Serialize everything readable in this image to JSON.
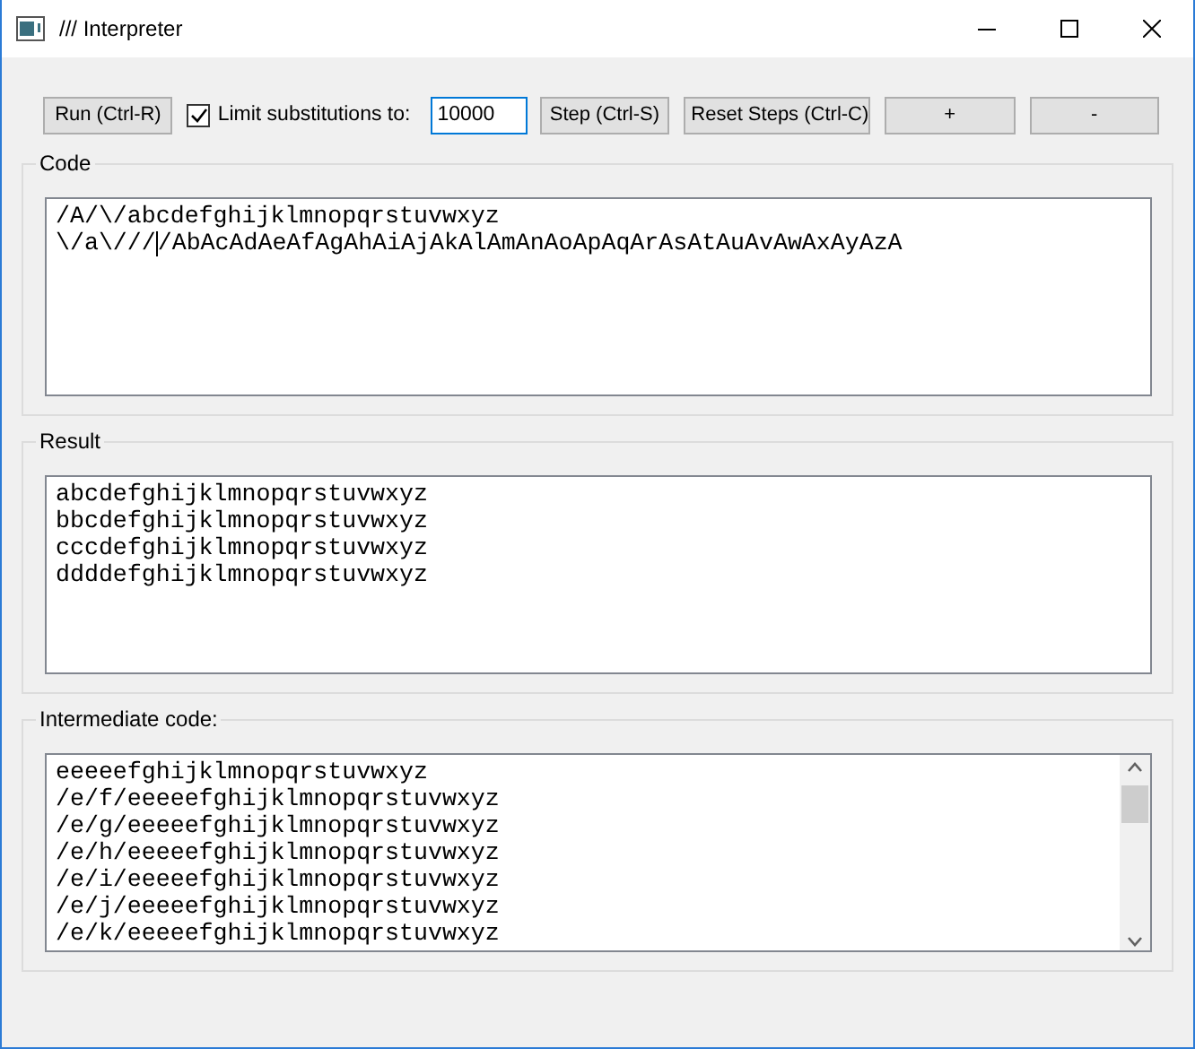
{
  "window": {
    "title": "/// Interpreter"
  },
  "toolbar": {
    "run_button": "Run (Ctrl-R)",
    "limit": {
      "label": "Limit substitutions to:",
      "checked": true
    },
    "limit_value": "10000",
    "step_button": "Step (Ctrl-S)",
    "reset_button": "Reset Steps (Ctrl-C)",
    "plus_button": "+",
    "minus_button": "-"
  },
  "code": {
    "title": "Code",
    "lines": [
      {
        "text": "/A/\\/abcdefghijklmnopqrstuvwxyz"
      },
      {
        "text": "\\/a\\///",
        "text_after_cursor": "/AbAcAdAeAfAgAhAiAjAkAlAmAnAoApAqArAsAtAuAvAwAxAyAzA"
      }
    ]
  },
  "result": {
    "title": "Result",
    "lines": [
      "abcdefghijklmnopqrstuvwxyz",
      "bbcdefghijklmnopqrstuvwxyz",
      "cccdefghijklmnopqrstuvwxyz",
      "ddddefghijklmnopqrstuvwxyz"
    ]
  },
  "intermediate": {
    "title": "Intermediate code:",
    "lines": [
      "eeeeefghijklmnopqrstuvwxyz",
      "/e/f/eeeeefghijklmnopqrstuvwxyz",
      "/e/g/eeeeefghijklmnopqrstuvwxyz",
      "/e/h/eeeeefghijklmnopqrstuvwxyz",
      "/e/i/eeeeefghijklmnopqrstuvwxyz",
      "/e/j/eeeeefghijklmnopqrstuvwxyz",
      "/e/k/eeeeefghijklmnopqrstuvwxyz"
    ]
  }
}
